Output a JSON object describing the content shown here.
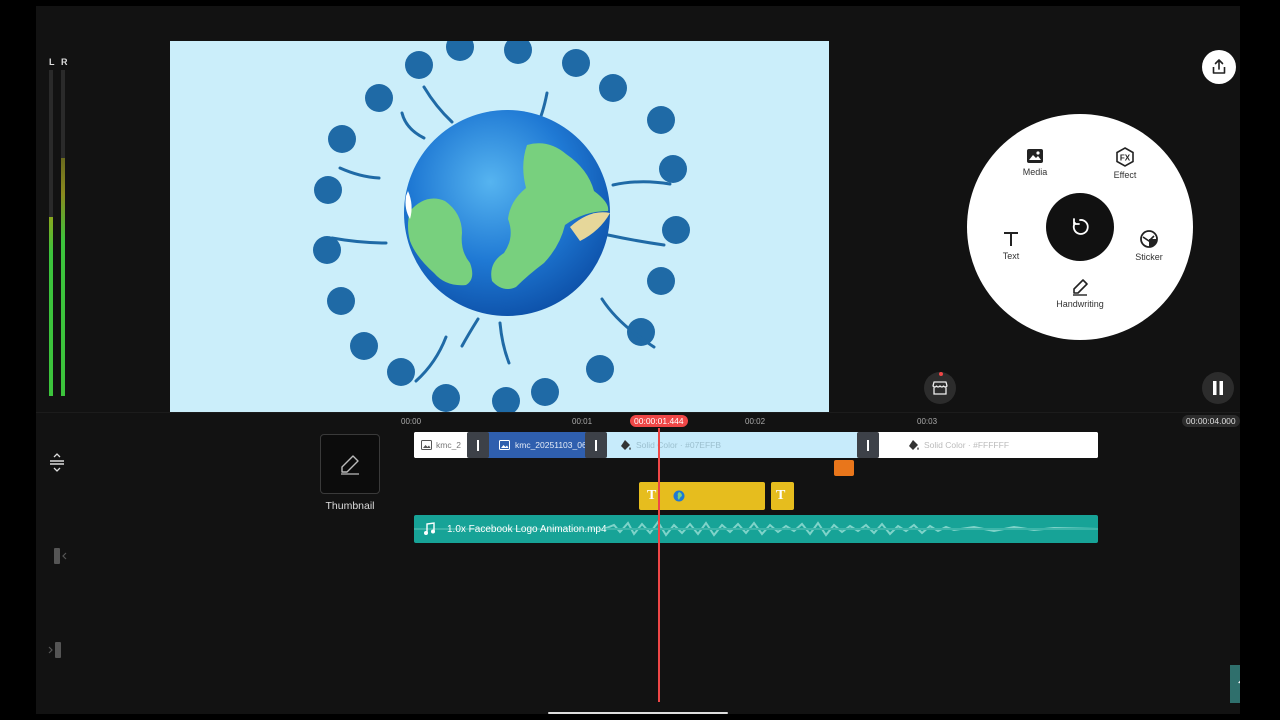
{
  "meter": {
    "left_label": "L",
    "right_label": "R",
    "left_level": 0.55,
    "right_level": 0.73
  },
  "preview": {
    "content": "globe-with-notification-dots"
  },
  "toolbar": {
    "share_icon": "share-icon",
    "pause_icon": "pause-icon",
    "store_icon": "store-icon"
  },
  "radial_menu": {
    "media_label": "Media",
    "effect_label": "Effect",
    "text_label": "Text",
    "sticker_label": "Sticker",
    "handwriting_label": "Handwriting",
    "center_icon": "undo-icon"
  },
  "timeline": {
    "ruler": [
      "00:00",
      "00:01",
      "00:02",
      "00:03"
    ],
    "playhead_time": "00:00:01.444",
    "total_time": "00:00:04.000",
    "thumbnail_label": "Thumbnail",
    "clips": {
      "first": "kmc_2",
      "second": "kmc_20251103_06",
      "third": "Solid Color · #07EFFB",
      "fourth": "Solid Color · #FFFFFF"
    },
    "text_layer_glyph": "T",
    "text_layer2_glyph": "T",
    "audio_label": "1.0x Facebook Logo Animation.mp4"
  },
  "colors": {
    "accent_red": "#ef4747",
    "audio_teal": "#17a397",
    "text_layer_yellow": "#e6bd1e",
    "selected_blue": "#2f5fae",
    "preview_bg": "#cbeefa"
  }
}
